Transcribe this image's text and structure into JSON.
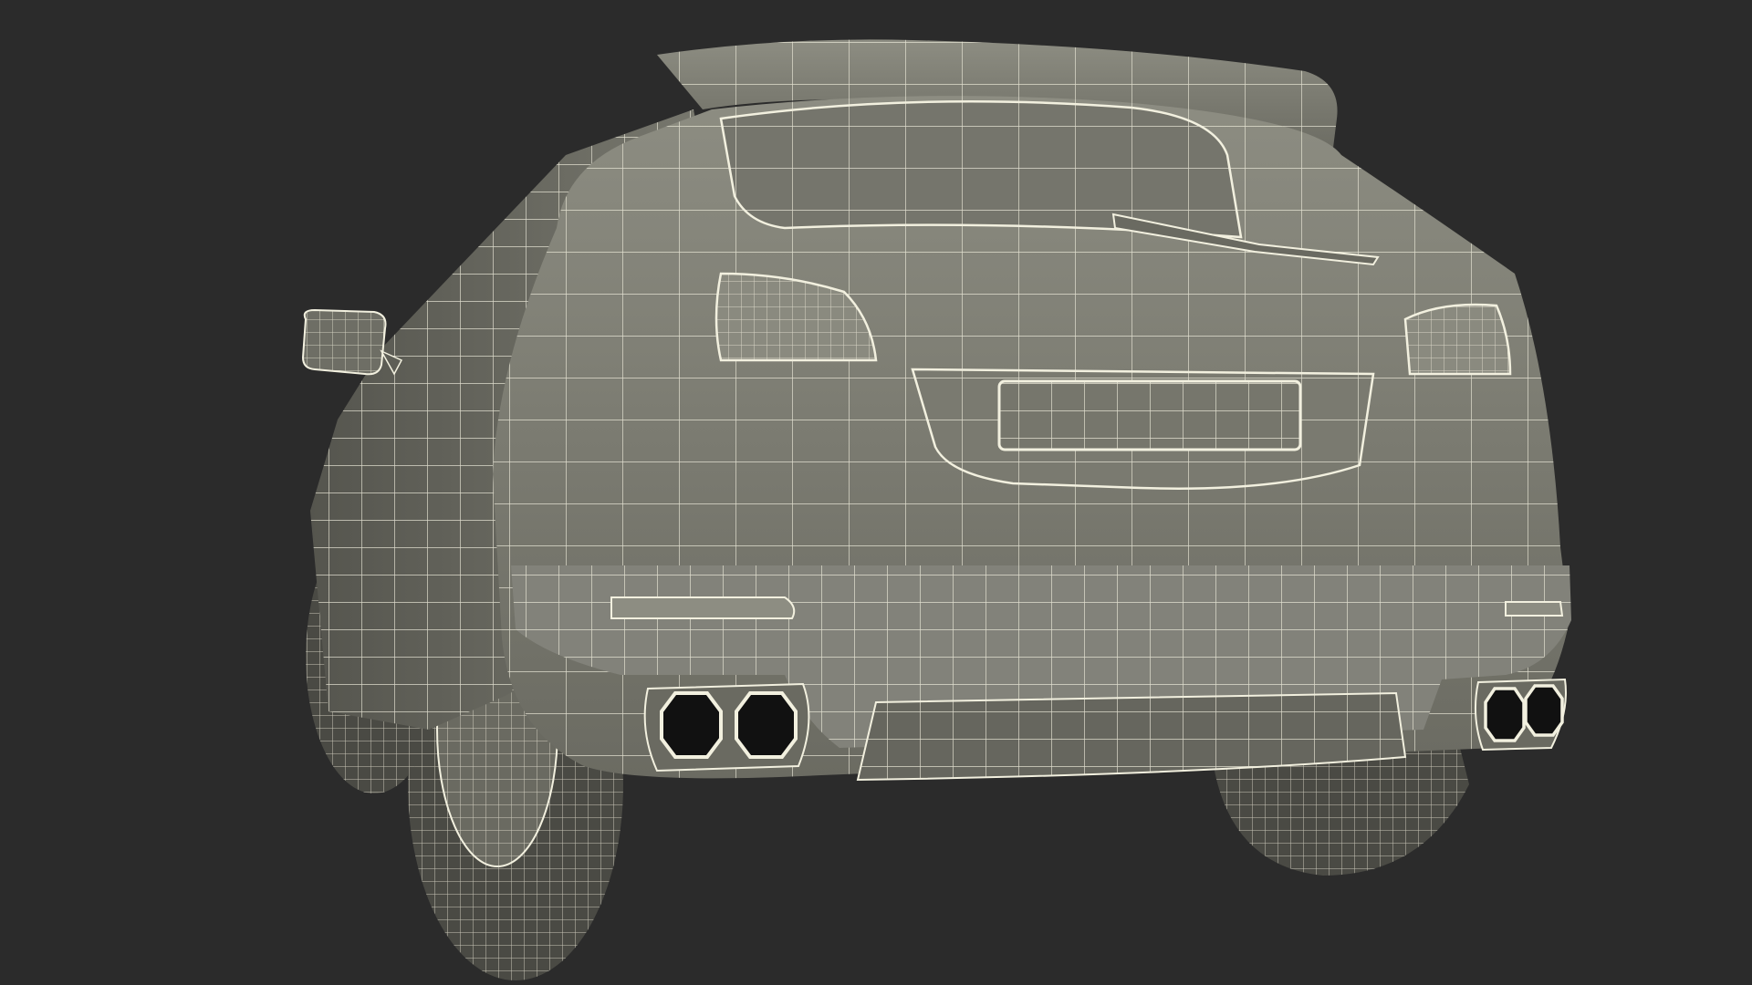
{
  "scene": {
    "subject": "car-rear-wireframe-render",
    "colors": {
      "background": "#2b2b2b",
      "body_fill": "#7d7d73",
      "body_fill_light": "#8e8e83",
      "body_fill_dark": "#5e5e56",
      "wire": "#f2f0df",
      "tire": "#3a3a36",
      "exhaust_inner": "#111111"
    }
  }
}
